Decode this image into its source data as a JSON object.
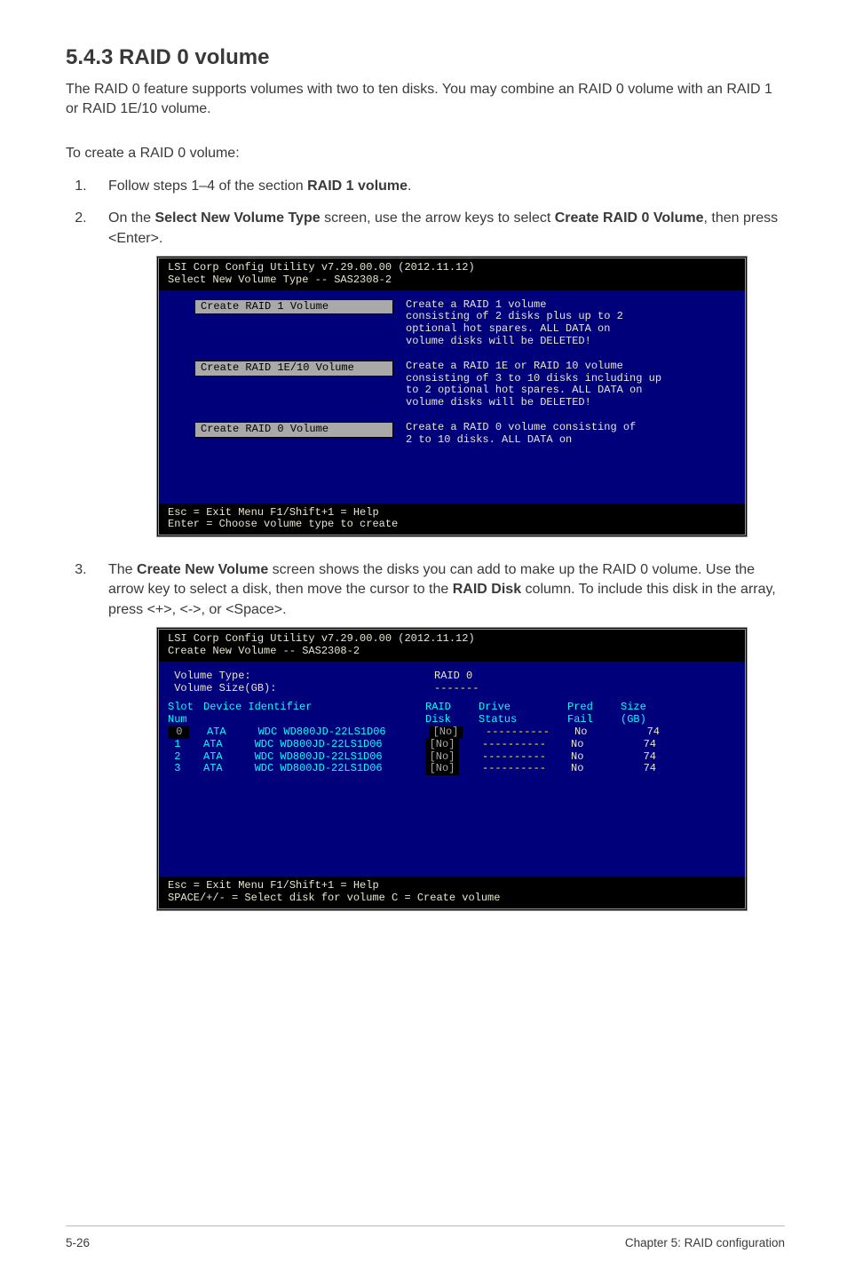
{
  "heading": "5.4.3       RAID 0 volume",
  "intro": "The RAID 0 feature supports volumes with two to ten disks. You may combine an RAID 0 volume with an RAID 1 or RAID 1E/10 volume.",
  "lead": "To create a RAID 0 volume:",
  "steps": {
    "s1_a": "Follow steps 1–4 of the section ",
    "s1_b": "RAID 1 volume",
    "s1_c": ".",
    "s2_a": "On the ",
    "s2_b": "Select New Volume Type",
    "s2_c": " screen, use the arrow keys to select ",
    "s2_d": "Create RAID 0 Volume",
    "s2_e": ", then press <Enter>.",
    "s3_a": "The ",
    "s3_b": "Create New Volume",
    "s3_c": " screen shows the disks you can add to make up the RAID 0 volume. Use the arrow key to select a disk, then move the cursor to the ",
    "s3_d": "RAID Disk",
    "s3_e": " column. To include this disk in the array, press <+>, <->, or <Space>."
  },
  "term1": {
    "titleLine": "LSI Corp Config Utility            v7.29.00.00 (2012.11.12)",
    "subtitle": "Select New Volume Type -- SAS2308-2",
    "opt1_label": "Create RAID 1 Volume",
    "opt1_desc": "Create a RAID 1 volume\nconsisting of 2 disks plus up to 2\noptional hot spares. ALL DATA on\nvolume disks will be DELETED!",
    "opt2_label": "Create RAID 1E/10 Volume",
    "opt2_desc": "Create a RAID 1E or RAID 10 volume\nconsisting of 3 to 10 disks including up\nto 2 optional hot spares. ALL DATA on\nvolume disks will be DELETED!",
    "opt3_label": "Create RAID 0 Volume",
    "opt3_desc": "Create a RAID 0 volume consisting of\n2 to 10 disks. ALL DATA on",
    "foot1": "Esc = Exit Menu        F1/Shift+1 = Help",
    "foot2": "Enter = Choose volume type to create"
  },
  "term2": {
    "titleLine": "LSI Corp Config Utility            v7.29.00.00 (2012.11.12)",
    "subtitle": "Create New Volume -- SAS2308-2",
    "vt_label": " Volume Type:",
    "vt_val": "RAID 0",
    "vs_label": " Volume Size(GB):",
    "vs_val": "-------",
    "hdr_slot": "Slot",
    "hdr_dev": "Device Identifier",
    "hdr_rd": "RAID",
    "hdr_rd2": "Disk",
    "hdr_drv": "Drive",
    "hdr_st": "Status",
    "hdr_pred": "Pred",
    "hdr_fail": "Fail",
    "hdr_size": "Size",
    "hdr_gb": "(GB)",
    "hdr_num": "Num",
    "rows": [
      {
        "slot": " 0",
        "dev": "ATA     WDC WD800JD-22LS1D06",
        "rd": "[No]",
        "drv": "----------",
        "pred": "No",
        "size": "   74"
      },
      {
        "slot": " 1",
        "dev": "ATA     WDC WD800JD-22LS1D06",
        "rd": "[No]",
        "drv": "----------",
        "pred": "No",
        "size": "   74"
      },
      {
        "slot": " 2",
        "dev": "ATA     WDC WD800JD-22LS1D06",
        "rd": "[No]",
        "drv": "----------",
        "pred": "No",
        "size": "   74"
      },
      {
        "slot": " 3",
        "dev": "ATA     WDC WD800JD-22LS1D06",
        "rd": "[No]",
        "drv": "----------",
        "pred": "No",
        "size": "   74"
      }
    ],
    "foot1": "Esc = Exit Menu        F1/Shift+1 = Help",
    "foot2": "SPACE/+/- = Select disk for volume       C = Create volume"
  },
  "footer": {
    "left": "5-26",
    "right": "Chapter 5: RAID configuration"
  }
}
